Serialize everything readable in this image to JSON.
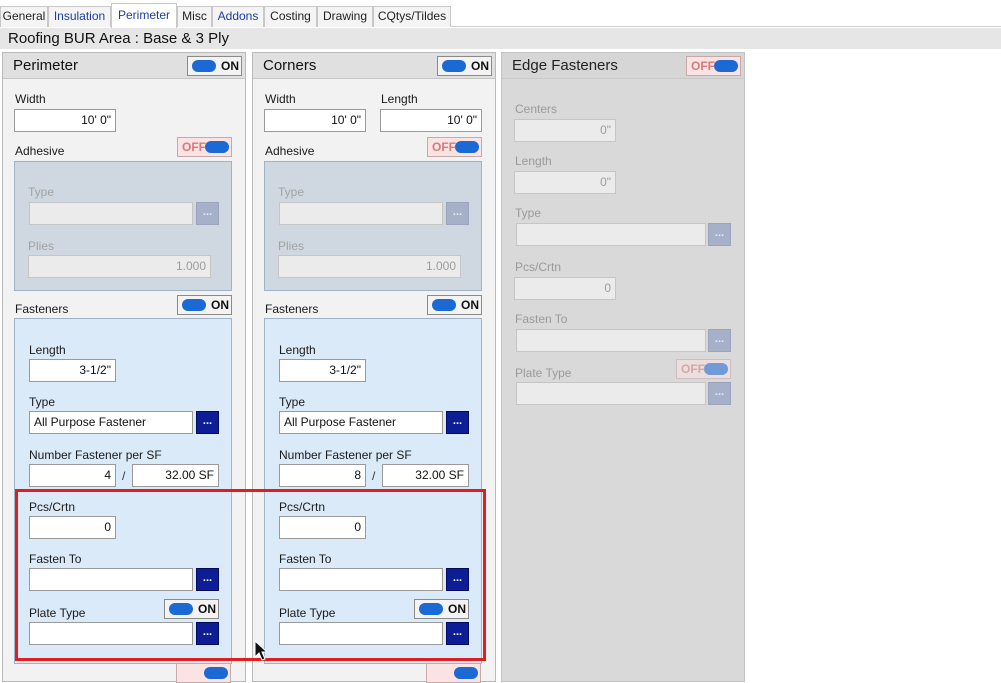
{
  "tabs": [
    {
      "label": "General",
      "state": "normal"
    },
    {
      "label": "Insulation",
      "state": "link"
    },
    {
      "label": "Perimeter",
      "state": "active"
    },
    {
      "label": "Misc",
      "state": "normal"
    },
    {
      "label": "Addons",
      "state": "link"
    },
    {
      "label": "Costing",
      "state": "normal"
    },
    {
      "label": "Drawing",
      "state": "normal"
    },
    {
      "label": "CQtys/Tildes",
      "state": "normal"
    }
  ],
  "page_title": "Roofing BUR Area : Base & 3 Ply",
  "toggle_text": {
    "on": "ON",
    "off": "OFF"
  },
  "dots_label": "...",
  "perimeter": {
    "title": "Perimeter",
    "enabled": "ON",
    "width_label": "Width",
    "width_value": "10' 0\"",
    "adhesive_label": "Adhesive",
    "adhesive_toggle": "OFF",
    "adhesive_type_label": "Type",
    "adhesive_type_value": "",
    "adhesive_plies_label": "Plies",
    "adhesive_plies_value": "1.000",
    "fasteners_label": "Fasteners",
    "fasteners_toggle": "ON",
    "length_label": "Length",
    "length_value": "3-1/2\"",
    "type_label": "Type",
    "type_value": "All Purpose Fastener",
    "number_label": "Number Fastener per SF",
    "number_value": "4",
    "per_sf_value": "32.00 SF",
    "pcs_label": "Pcs/Crtn",
    "pcs_value": "0",
    "fasten_to_label": "Fasten To",
    "fasten_to_value": "",
    "plate_type_label": "Plate Type",
    "plate_type_toggle": "ON",
    "plate_type_value": ""
  },
  "corners": {
    "title": "Corners",
    "enabled": "ON",
    "width_label": "Width",
    "width_value": "10' 0\"",
    "length_label_top": "Length",
    "length_value_top": "10' 0\"",
    "adhesive_label": "Adhesive",
    "adhesive_toggle": "OFF",
    "adhesive_type_label": "Type",
    "adhesive_type_value": "",
    "adhesive_plies_label": "Plies",
    "adhesive_plies_value": "1.000",
    "fasteners_label": "Fasteners",
    "fasteners_toggle": "ON",
    "length_label": "Length",
    "length_value": "3-1/2\"",
    "type_label": "Type",
    "type_value": "All Purpose Fastener",
    "number_label": "Number Fastener per SF",
    "number_value": "8",
    "per_sf_value": "32.00 SF",
    "pcs_label": "Pcs/Crtn",
    "pcs_value": "0",
    "fasten_to_label": "Fasten To",
    "fasten_to_value": "",
    "plate_type_label": "Plate Type",
    "plate_type_toggle": "ON",
    "plate_type_value": ""
  },
  "edge": {
    "title": "Edge Fasteners",
    "enabled": "OFF",
    "centers_label": "Centers",
    "centers_value": "0\"",
    "length_label": "Length",
    "length_value": "0\"",
    "type_label": "Type",
    "type_value": "",
    "pcs_label": "Pcs/Crtn",
    "pcs_value": "0",
    "fasten_to_label": "Fasten To",
    "fasten_to_value": "",
    "plate_type_label": "Plate Type",
    "plate_type_toggle": "OFF",
    "plate_type_value": ""
  },
  "colors": {
    "accent_blue": "#1b69d5",
    "dots_button": "#0c1d96",
    "highlight": "#df1f1f",
    "off_tint": "#fbe3e3"
  }
}
